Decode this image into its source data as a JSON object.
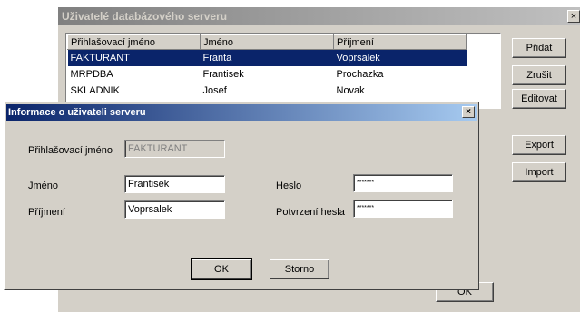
{
  "bg_window": {
    "title": "Uživatelé databázového serveru",
    "close_glyph": "×",
    "columns": [
      "Přihlašovací jméno",
      "Jméno",
      "Příjmení"
    ],
    "rows": [
      [
        "FAKTURANT",
        "Franta",
        "Voprsalek"
      ],
      [
        "MRPDBA",
        "Frantisek",
        "Prochazka"
      ],
      [
        "SKLADNIK",
        "Josef",
        "Novak"
      ]
    ],
    "selected_row": 0,
    "buttons": {
      "add": "Přidat",
      "delete": "Zrušit",
      "edit": "Editovat",
      "export": "Export",
      "import": "Import",
      "ok": "OK"
    }
  },
  "dialog": {
    "title": "Informace o uživateli serveru",
    "close_glyph": "×",
    "login_label": "Přihlašovací jméno",
    "login_value": "FAKTURANT",
    "first_name_label": "Jméno",
    "first_name_value": "Frantisek",
    "last_name_label": "Příjmení",
    "last_name_value": "Voprsalek",
    "password_label": "Heslo",
    "password_value": "*******",
    "password_confirm_label": "Potvrzení hesla",
    "password_confirm_value": "*******",
    "ok_label": "OK",
    "cancel_label": "Storno"
  }
}
